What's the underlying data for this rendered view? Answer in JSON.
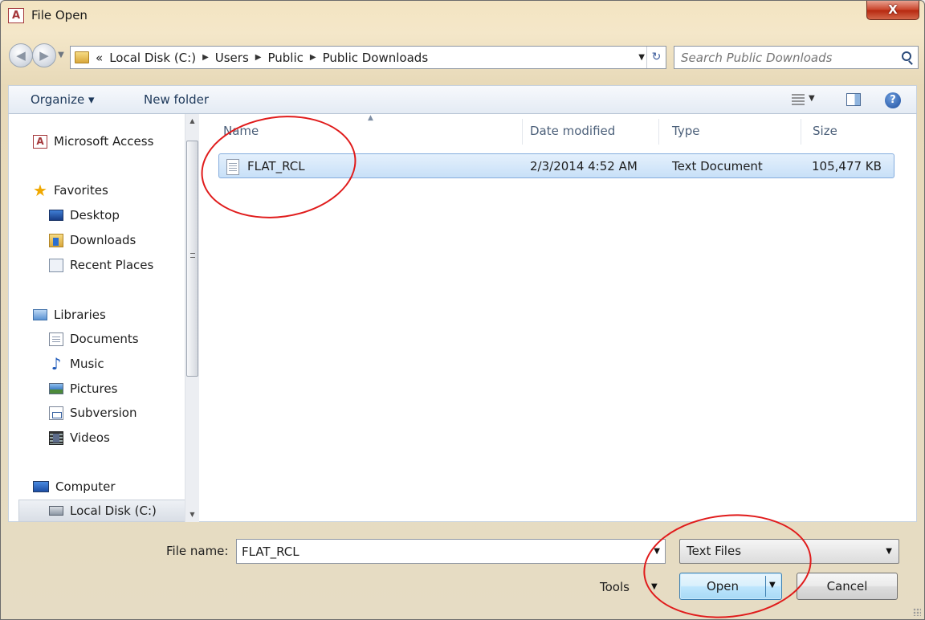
{
  "window": {
    "title": "File Open",
    "close_label": "X"
  },
  "address": {
    "overflow": "«",
    "crumbs": [
      "Local Disk (C:)",
      "Users",
      "Public",
      "Public Downloads"
    ],
    "search_placeholder": "Search Public Downloads"
  },
  "toolbar": {
    "organize": "Organize ▾",
    "new_folder": "New folder"
  },
  "nav": {
    "items": [
      {
        "label": "Microsoft Access",
        "icon": "access-icon"
      },
      {
        "label": "Favorites",
        "icon": "star-icon"
      },
      {
        "label": "Desktop",
        "icon": "desktop-icon"
      },
      {
        "label": "Downloads",
        "icon": "downloads-icon"
      },
      {
        "label": "Recent Places",
        "icon": "recent-places-icon"
      },
      {
        "label": "Libraries",
        "icon": "libraries-icon"
      },
      {
        "label": "Documents",
        "icon": "documents-icon"
      },
      {
        "label": "Music",
        "icon": "music-icon"
      },
      {
        "label": "Pictures",
        "icon": "pictures-icon"
      },
      {
        "label": "Subversion",
        "icon": "subversion-icon"
      },
      {
        "label": "Videos",
        "icon": "videos-icon"
      },
      {
        "label": "Computer",
        "icon": "computer-icon"
      },
      {
        "label": "Local Disk (C:)",
        "icon": "local-disk-icon"
      }
    ],
    "selected": "Local Disk (C:)"
  },
  "files": {
    "columns": [
      "Name",
      "Date modified",
      "Type",
      "Size"
    ],
    "rows": [
      {
        "name": "FLAT_RCL",
        "date": "2/3/2014 4:52 AM",
        "type": "Text Document",
        "size": "105,477 KB"
      }
    ]
  },
  "footer": {
    "file_name_label": "File name:",
    "file_name_value": "FLAT_RCL",
    "filter_value": "Text Files",
    "tools_label": "Tools",
    "open_label": "Open",
    "cancel_label": "Cancel"
  },
  "colors": {
    "annotation": "#e01b1b",
    "selection": "#c8e0f8",
    "accent": "#1e395b"
  }
}
